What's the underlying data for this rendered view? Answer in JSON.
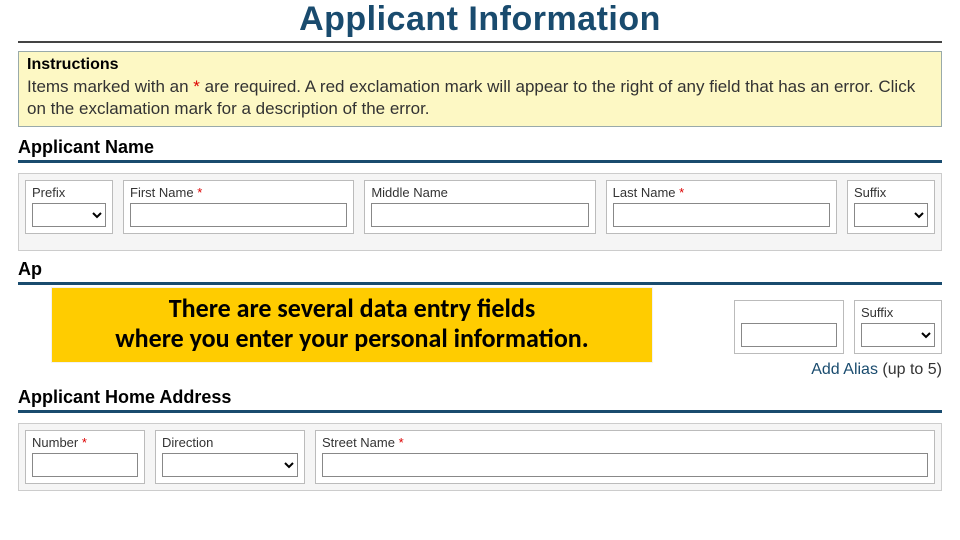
{
  "title": "Applicant Information",
  "instructions": {
    "heading": "Instructions",
    "text_before": "Items marked with an ",
    "asterisk": "*",
    "text_after": " are required. A red exclamation mark will appear to the right of any field that has an error. Click on the exclamation mark for a description of the error."
  },
  "sections": {
    "name": {
      "heading": "Applicant Name",
      "fields": {
        "prefix": {
          "label": "Prefix",
          "req": false,
          "value": ""
        },
        "first": {
          "label": "First Name",
          "req": true,
          "value": ""
        },
        "middle": {
          "label": "Middle Name",
          "req": false,
          "value": ""
        },
        "last": {
          "label": "Last Name",
          "req": true,
          "value": ""
        },
        "suffix": {
          "label": "Suffix",
          "req": false,
          "value": ""
        }
      }
    },
    "alias": {
      "heading_stub": "Ap",
      "visible_right": {
        "suffix": {
          "label": "Suffix",
          "req": false,
          "value": ""
        }
      },
      "add_link": "Add Alias",
      "add_note": "(up to 5)"
    },
    "address": {
      "heading": "Applicant Home Address",
      "fields": {
        "number": {
          "label": "Number",
          "req": true,
          "value": ""
        },
        "direction": {
          "label": "Direction",
          "req": false,
          "value": ""
        },
        "street": {
          "label": "Street Name",
          "req": true,
          "value": ""
        }
      }
    }
  },
  "callout": {
    "line1": "There are several data entry fields",
    "line2": "where you enter your personal information."
  },
  "req_marker": "*"
}
